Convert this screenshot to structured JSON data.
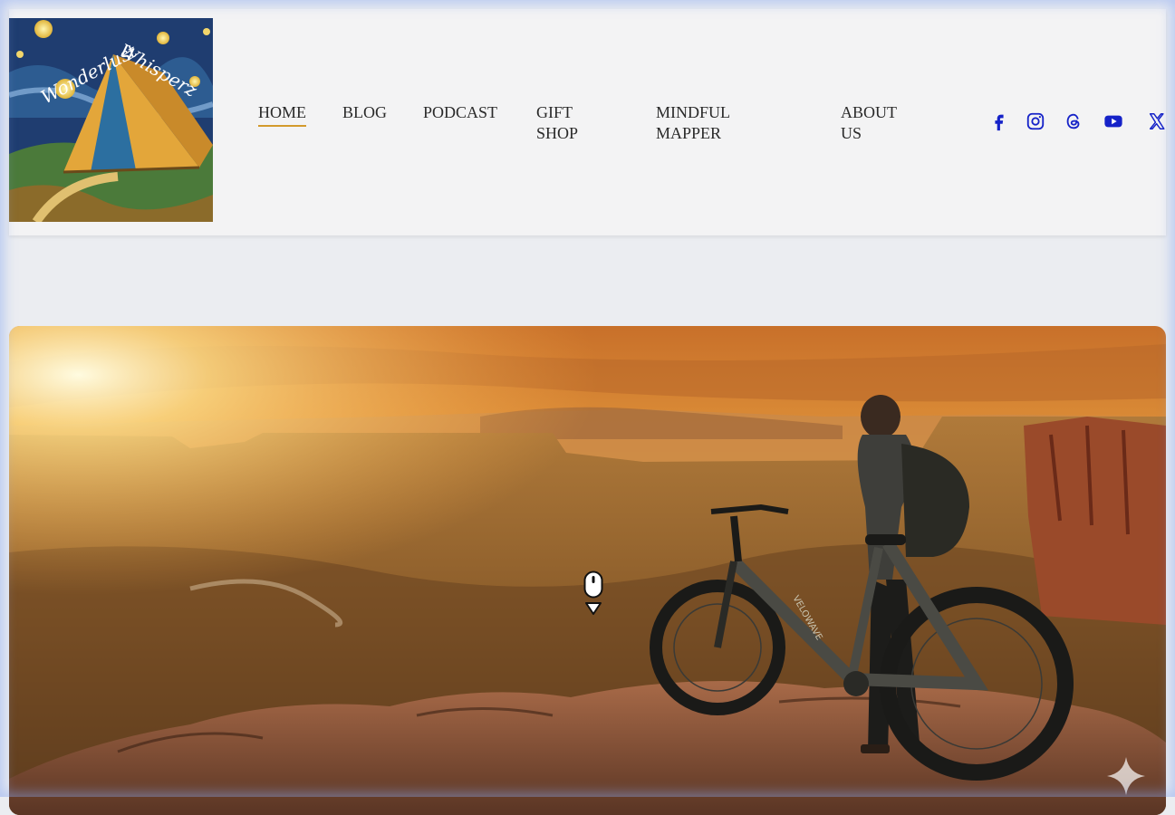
{
  "logo": {
    "text": "Wonderlust Whisperz"
  },
  "nav": {
    "items": [
      {
        "label": "HOME",
        "active": true
      },
      {
        "label": "BLOG",
        "active": false
      },
      {
        "label": "PODCAST",
        "active": false
      },
      {
        "label": "GIFT\nSHOP",
        "active": false
      },
      {
        "label": "MINDFUL\nMAPPER",
        "active": false
      },
      {
        "label": "ABOUT\nUS",
        "active": false
      }
    ]
  },
  "social": {
    "color": "#1522c8",
    "icons": [
      "facebook-icon",
      "instagram-icon",
      "threads-icon",
      "youtube-icon",
      "x-icon"
    ]
  },
  "hero": {
    "bike_brand": "VELOWAVE",
    "accent": "#d39a2c"
  }
}
